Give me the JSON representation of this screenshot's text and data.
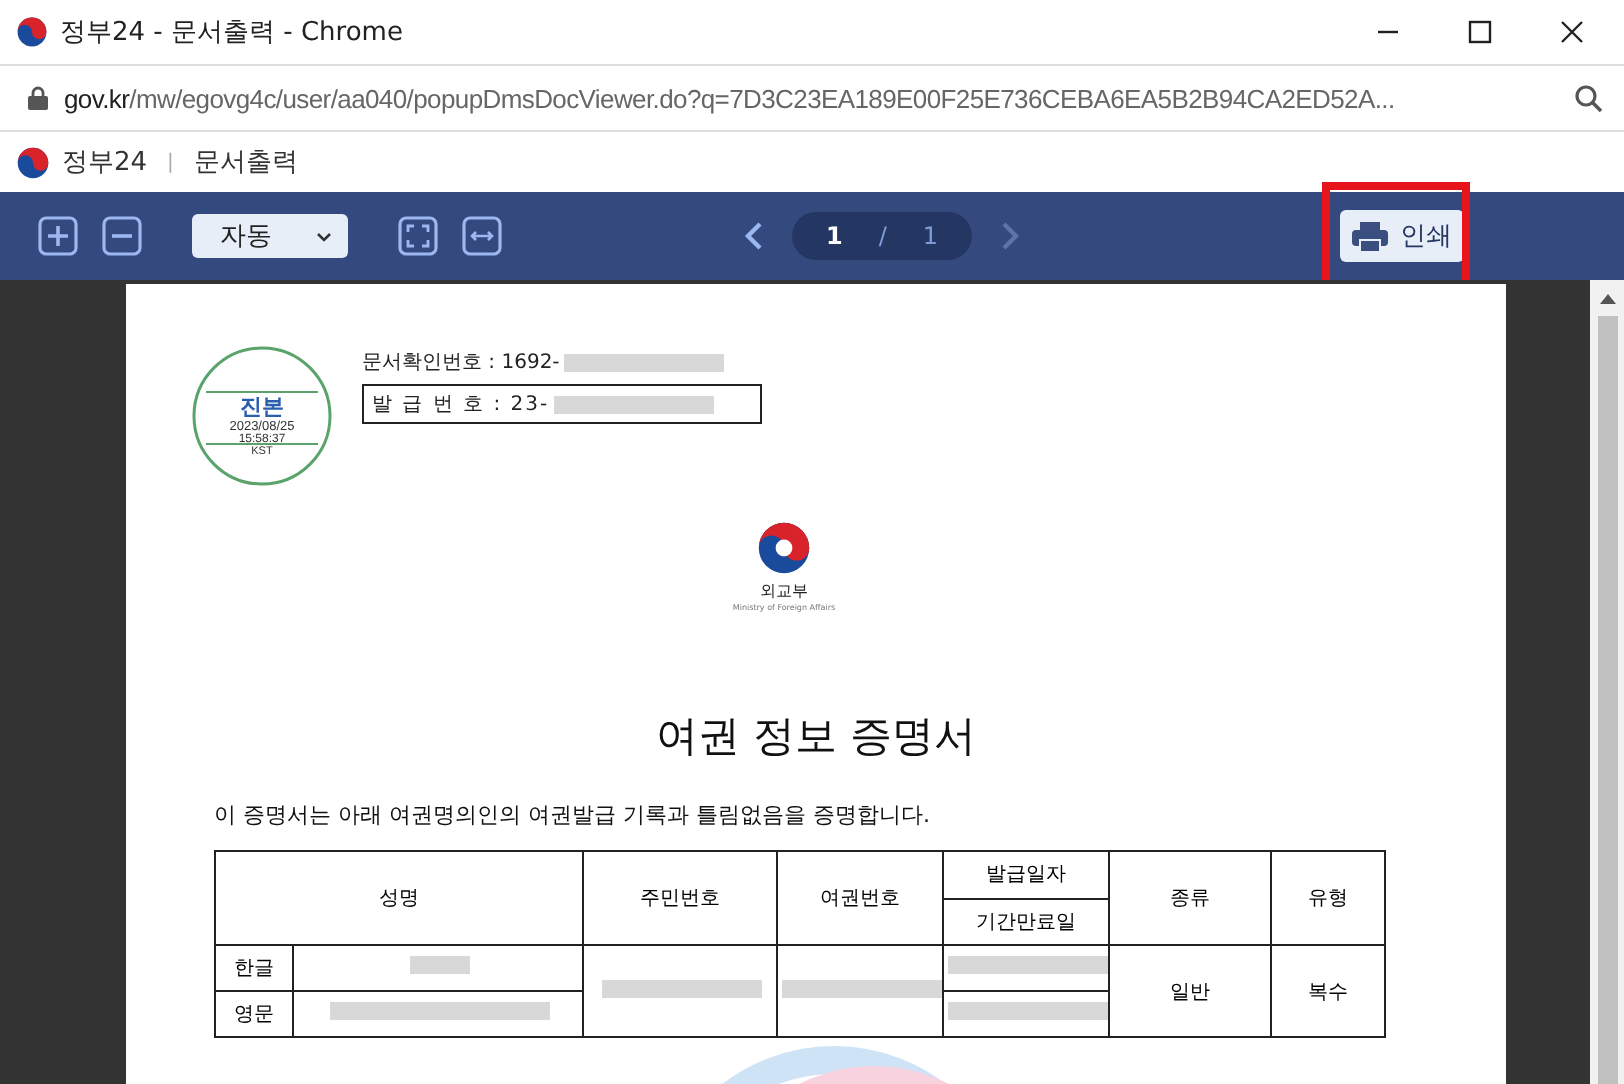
{
  "window": {
    "title": "정부24 - 문서출력 - Chrome"
  },
  "address_bar": {
    "url_host": "gov.kr",
    "url_path": "/mw/egovg4c/user/aa040/popupDmsDocViewer.do?q=7D3C23EA189E00F25E736CEBA6EA5B2B94CA2ED52A..."
  },
  "site_header": {
    "brand": "정부24",
    "separator": "|",
    "page": "문서출력"
  },
  "toolbar": {
    "zoom_select": "자동",
    "page_current": "1",
    "page_separator": "/",
    "page_total": "1",
    "print_button": "인쇄",
    "print_highlighted": true
  },
  "document": {
    "stamp": {
      "title": "진본",
      "date": "2023/08/25",
      "time": "15:58:37",
      "zone": "KST"
    },
    "confirm_number": "문서확인번호 : 1692-",
    "issue_number": "발 급 번 호 : 23-",
    "ministry": {
      "name": "외교부",
      "english": "Ministry of Foreign Affairs"
    },
    "title": "여권 정보 증명서",
    "statement": "이 증명서는 아래 여권명의인의 여권발급 기록과 틀림없음을 증명합니다.",
    "table": {
      "headers": [
        "성명",
        "주민번호",
        "여권번호",
        "발급일자",
        "기간만료일",
        "종류",
        "유형"
      ],
      "rows": [
        {
          "label": "한글"
        },
        {
          "label": "영문"
        }
      ],
      "type": "일반",
      "kind": "복수"
    }
  }
}
